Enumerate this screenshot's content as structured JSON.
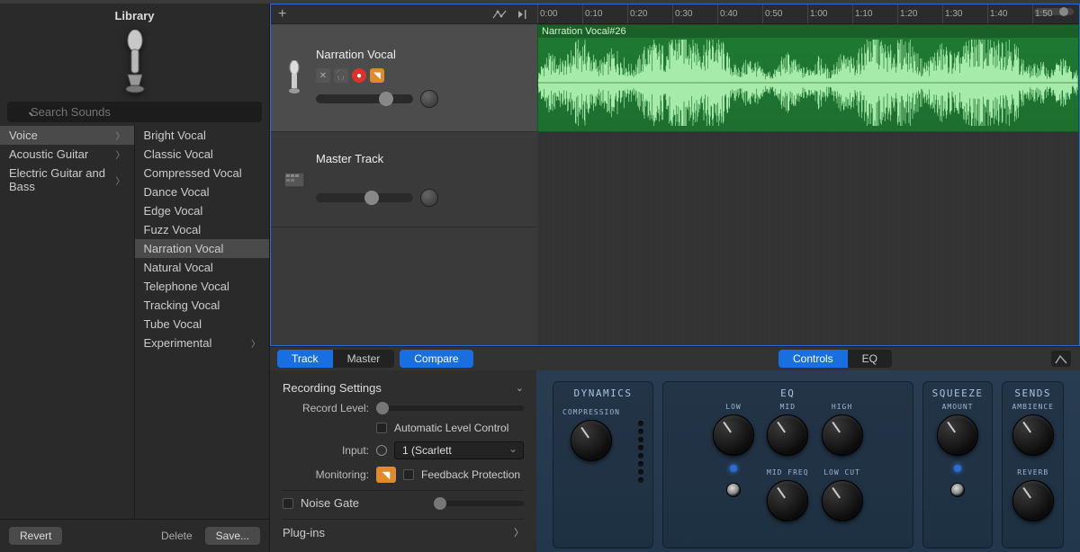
{
  "library": {
    "title": "Library",
    "search_placeholder": "Search Sounds",
    "categories": [
      {
        "label": "Voice",
        "has_children": true,
        "selected": true
      },
      {
        "label": "Acoustic Guitar",
        "has_children": true
      },
      {
        "label": "Electric Guitar and Bass",
        "has_children": true
      }
    ],
    "patches": [
      {
        "label": "Bright Vocal"
      },
      {
        "label": "Classic Vocal"
      },
      {
        "label": "Compressed Vocal"
      },
      {
        "label": "Dance Vocal"
      },
      {
        "label": "Edge Vocal"
      },
      {
        "label": "Fuzz Vocal"
      },
      {
        "label": "Narration Vocal",
        "selected": true
      },
      {
        "label": "Natural Vocal"
      },
      {
        "label": "Telephone Vocal"
      },
      {
        "label": "Tracking Vocal"
      },
      {
        "label": "Tube Vocal"
      },
      {
        "label": "Experimental",
        "has_children": true
      }
    ],
    "footer": {
      "revert": "Revert",
      "delete": "Delete",
      "save": "Save..."
    }
  },
  "tracks": {
    "toolbar": {
      "add": "+"
    },
    "items": [
      {
        "name": "Narration Vocal",
        "selected": true,
        "mute": true,
        "headphones": true,
        "record": true,
        "input": true
      },
      {
        "name": "Master Track"
      }
    ],
    "region": {
      "label": "Narration Vocal#26"
    }
  },
  "timeline": {
    "marks": [
      "0:00",
      "0:10",
      "0:20",
      "0:30",
      "0:40",
      "0:50",
      "1:00",
      "1:10",
      "1:20",
      "1:30",
      "1:40",
      "1:50"
    ]
  },
  "inspector": {
    "tabs_left": {
      "track": "Track",
      "master": "Master",
      "compare": "Compare"
    },
    "tabs_right": {
      "controls": "Controls",
      "eq": "EQ"
    },
    "recording": {
      "heading": "Recording Settings",
      "record_level": "Record Level:",
      "auto_level": "Automatic Level Control",
      "input_label": "Input:",
      "input_value": "1  (Scarlett",
      "monitoring": "Monitoring:",
      "feedback": "Feedback Protection",
      "noise_gate": "Noise Gate",
      "plugins": "Plug-ins"
    },
    "fx": {
      "dynamics": {
        "title": "DYNAMICS",
        "compression": "COMPRESSION"
      },
      "eq": {
        "title": "EQ",
        "low": "LOW",
        "mid": "MID",
        "high": "HIGH",
        "mid_freq": "MID FREQ",
        "low_cut": "LOW CUT"
      },
      "squeeze": {
        "title": "SQUEEZE",
        "amount": "AMOUNT"
      },
      "sends": {
        "title": "SENDS",
        "ambience": "AMBIENCE",
        "reverb": "REVERB"
      }
    }
  }
}
